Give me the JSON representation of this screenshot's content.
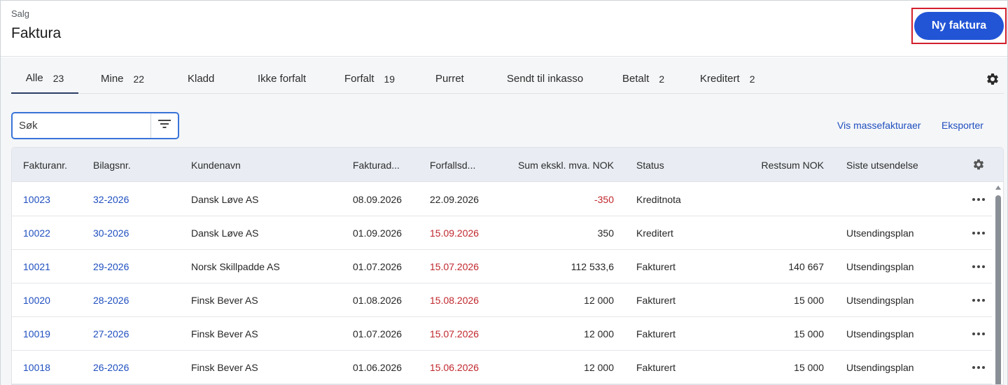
{
  "header": {
    "breadcrumb": "Salg",
    "title": "Faktura",
    "new_button": "Ny faktura"
  },
  "tabs": [
    {
      "label": "Alle",
      "count": "23"
    },
    {
      "label": "Mine",
      "count": "22"
    },
    {
      "label": "Kladd",
      "count": ""
    },
    {
      "label": "Ikke forfalt",
      "count": ""
    },
    {
      "label": "Forfalt",
      "count": "19"
    },
    {
      "label": "Purret",
      "count": ""
    },
    {
      "label": "Sendt til inkasso",
      "count": ""
    },
    {
      "label": "Betalt",
      "count": "2"
    },
    {
      "label": "Kreditert",
      "count": "2"
    }
  ],
  "search": {
    "placeholder": "Søk"
  },
  "actions": {
    "mass_invoices": "Vis massefakturaer",
    "export": "Eksporter"
  },
  "table": {
    "columns": [
      "Fakturanr.",
      "Bilagsnr.",
      "Kundenavn",
      "Fakturad...",
      "Forfallsd...",
      "Sum ekskl. mva. NOK",
      "Status",
      "Restsum NOK",
      "Siste utsendelse"
    ],
    "rows": [
      {
        "invoice_no": "10023",
        "voucher_no": "32-2026",
        "customer": "Dansk Løve AS",
        "invoice_date": "08.09.2026",
        "due_date": "22.09.2026",
        "due_overdue": false,
        "sum": "-350",
        "sum_negative": true,
        "status": "Kreditnota",
        "remaining": "",
        "last_sent": ""
      },
      {
        "invoice_no": "10022",
        "voucher_no": "30-2026",
        "customer": "Dansk Løve AS",
        "invoice_date": "01.09.2026",
        "due_date": "15.09.2026",
        "due_overdue": true,
        "sum": "350",
        "sum_negative": false,
        "status": "Kreditert",
        "remaining": "",
        "last_sent": "Utsendingsplan"
      },
      {
        "invoice_no": "10021",
        "voucher_no": "29-2026",
        "customer": "Norsk Skillpadde AS",
        "invoice_date": "01.07.2026",
        "due_date": "15.07.2026",
        "due_overdue": true,
        "sum": "112 533,6",
        "sum_negative": false,
        "status": "Fakturert",
        "remaining": "140 667",
        "last_sent": "Utsendingsplan"
      },
      {
        "invoice_no": "10020",
        "voucher_no": "28-2026",
        "customer": "Finsk Bever AS",
        "invoice_date": "01.08.2026",
        "due_date": "15.08.2026",
        "due_overdue": true,
        "sum": "12 000",
        "sum_negative": false,
        "status": "Fakturert",
        "remaining": "15 000",
        "last_sent": "Utsendingsplan"
      },
      {
        "invoice_no": "10019",
        "voucher_no": "27-2026",
        "customer": "Finsk Bever AS",
        "invoice_date": "01.07.2026",
        "due_date": "15.07.2026",
        "due_overdue": true,
        "sum": "12 000",
        "sum_negative": false,
        "status": "Fakturert",
        "remaining": "15 000",
        "last_sent": "Utsendingsplan"
      },
      {
        "invoice_no": "10018",
        "voucher_no": "26-2026",
        "customer": "Finsk Bever AS",
        "invoice_date": "01.06.2026",
        "due_date": "15.06.2026",
        "due_overdue": true,
        "sum": "12 000",
        "sum_negative": false,
        "status": "Fakturert",
        "remaining": "15 000",
        "last_sent": "Utsendingsplan"
      }
    ]
  },
  "icons": {
    "tabs_settings": "gear-icon",
    "filter": "filter-icon",
    "column_settings": "gear-icon",
    "row_menu": "more-horizontal-icon"
  },
  "colors": {
    "primary_button": "#2255d6",
    "link": "#1f4fbf",
    "overdue": "#c0272d",
    "highlight": "#d3202c"
  }
}
